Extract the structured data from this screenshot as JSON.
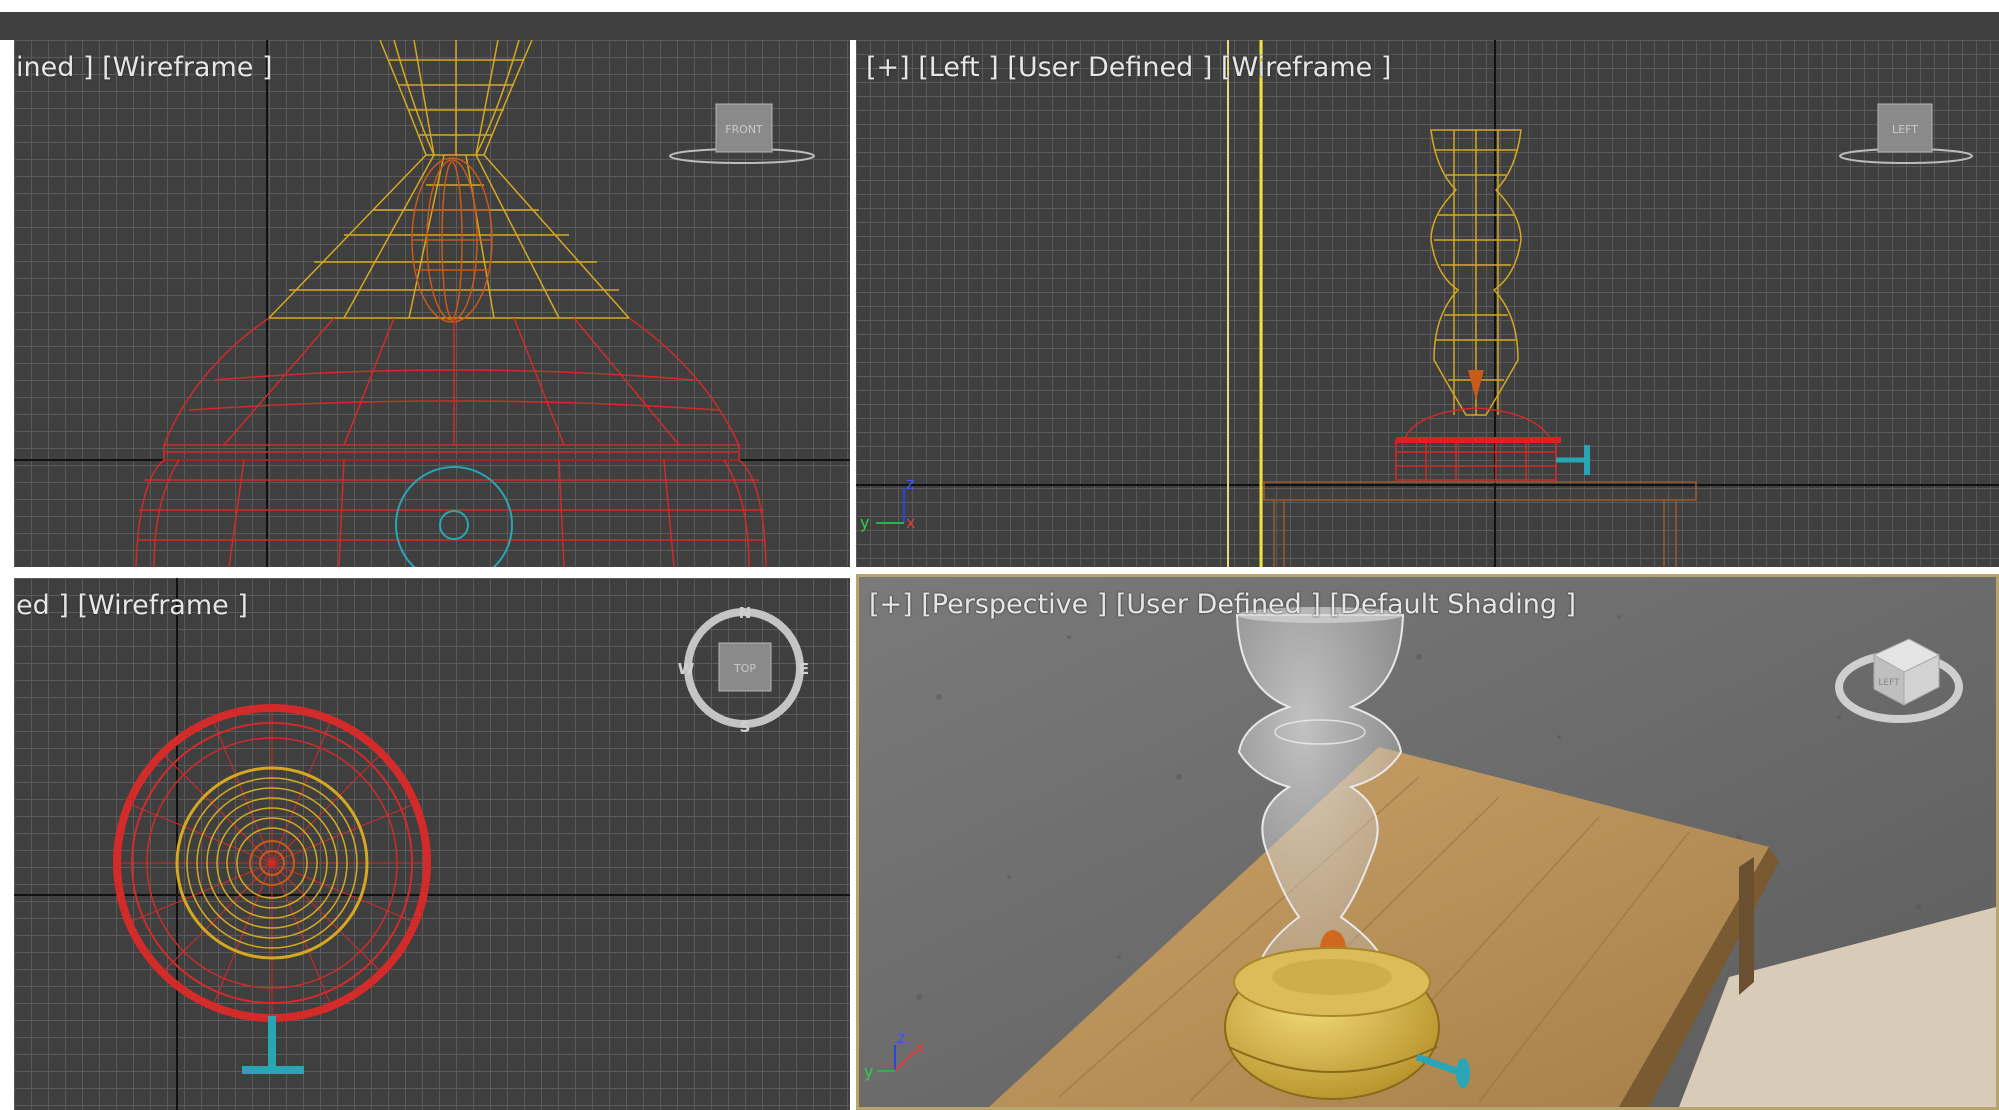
{
  "viewports": {
    "front": {
      "label": "ined ] [Wireframe ]",
      "viewcube": "FRONT"
    },
    "left": {
      "label": "[+] [Left ] [User Defined ] [Wireframe ]",
      "viewcube": "LEFT"
    },
    "top": {
      "label": "ed ] [Wireframe ]",
      "viewcube": "TOP",
      "compass": {
        "n": "N",
        "s": "S",
        "e": "E",
        "w": "W"
      }
    },
    "perspective": {
      "label": "[+] [Perspective ] [User Defined ] [Default Shading ]",
      "viewcube": "LEFT"
    }
  },
  "axes": {
    "x": "x",
    "y": "y",
    "z": "z"
  },
  "colors": {
    "viewport_bg": "#3f3f3f",
    "grid_line": "#5a5a5a",
    "grid_axis": "#111111",
    "hourglass_wire": "#d6a820",
    "base_wire": "#d32a2a",
    "sand_wire": "#c85a1a",
    "table_wire": "#9a5a32",
    "gizmo": "#2aa5b5",
    "active_border": "#b6a46a"
  }
}
